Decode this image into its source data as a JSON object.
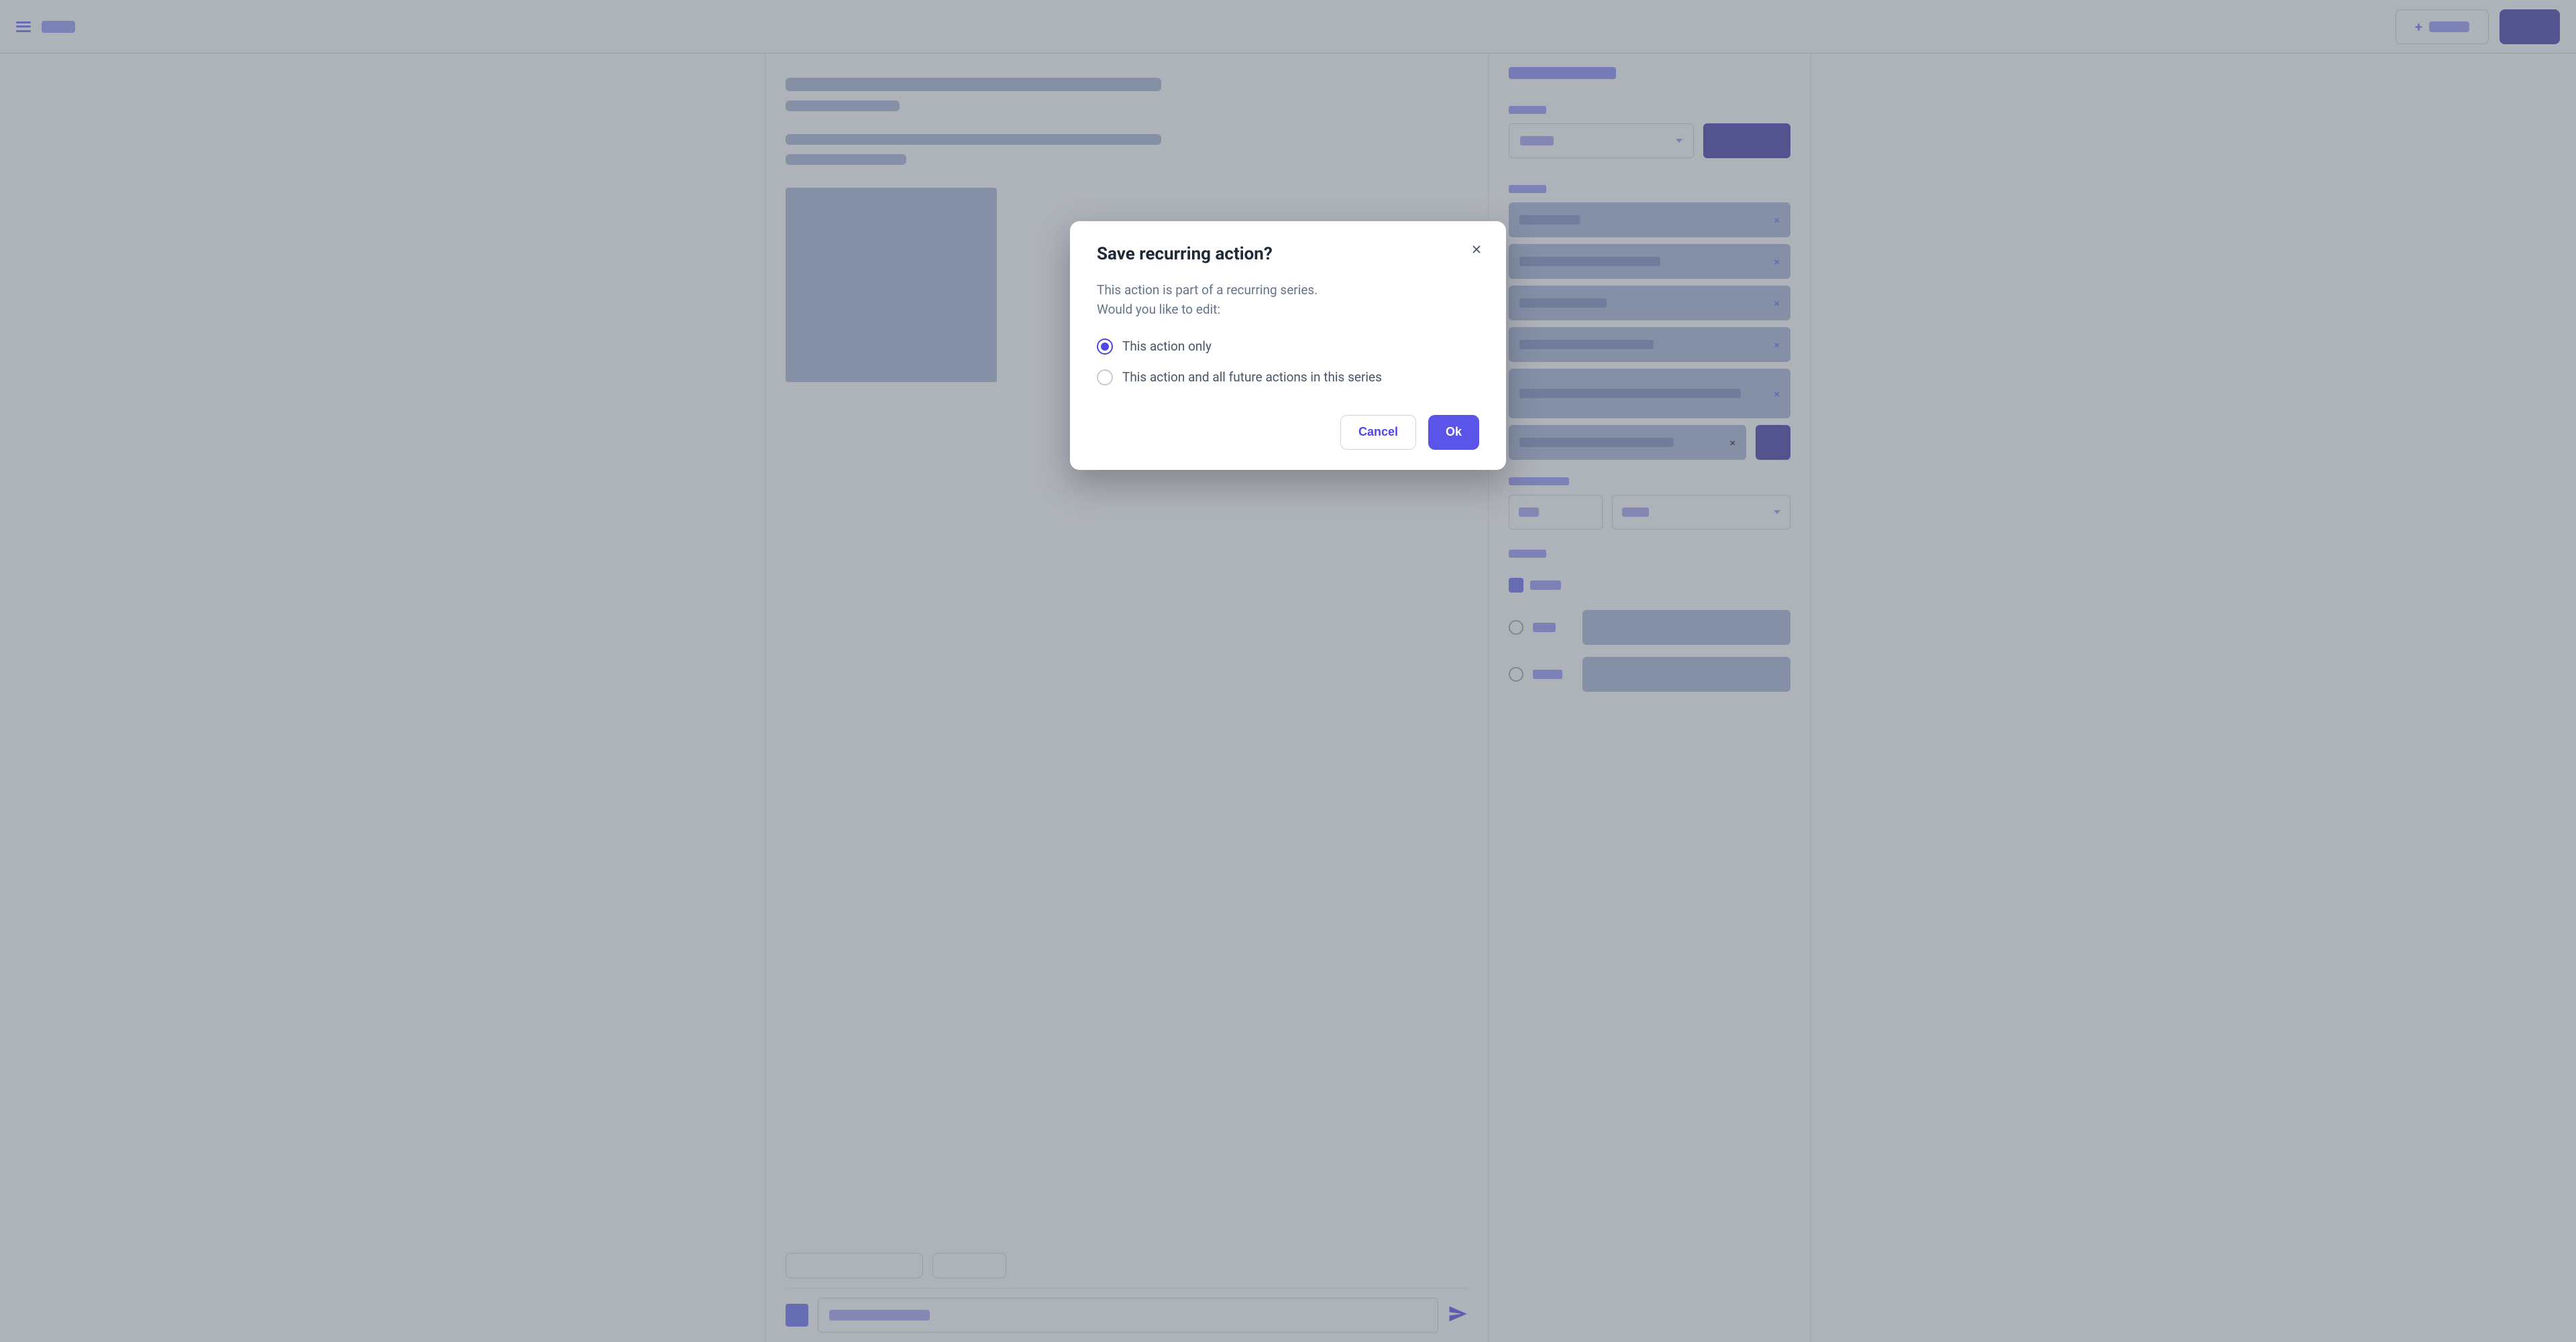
{
  "modal": {
    "title": "Save recurring action?",
    "body_line1": "This action is part of a recurring series.",
    "body_line2": "Would you like to edit:",
    "options": [
      {
        "label": "This action only",
        "selected": true
      },
      {
        "label": "This action and all future actions in this series",
        "selected": false
      }
    ],
    "cancel_label": "Cancel",
    "ok_label": "Ok"
  },
  "colors": {
    "primary": "#5b54e8",
    "primary_dark": "#3730a3",
    "text_muted": "#64748b",
    "skeleton": "#a5b4d8"
  }
}
